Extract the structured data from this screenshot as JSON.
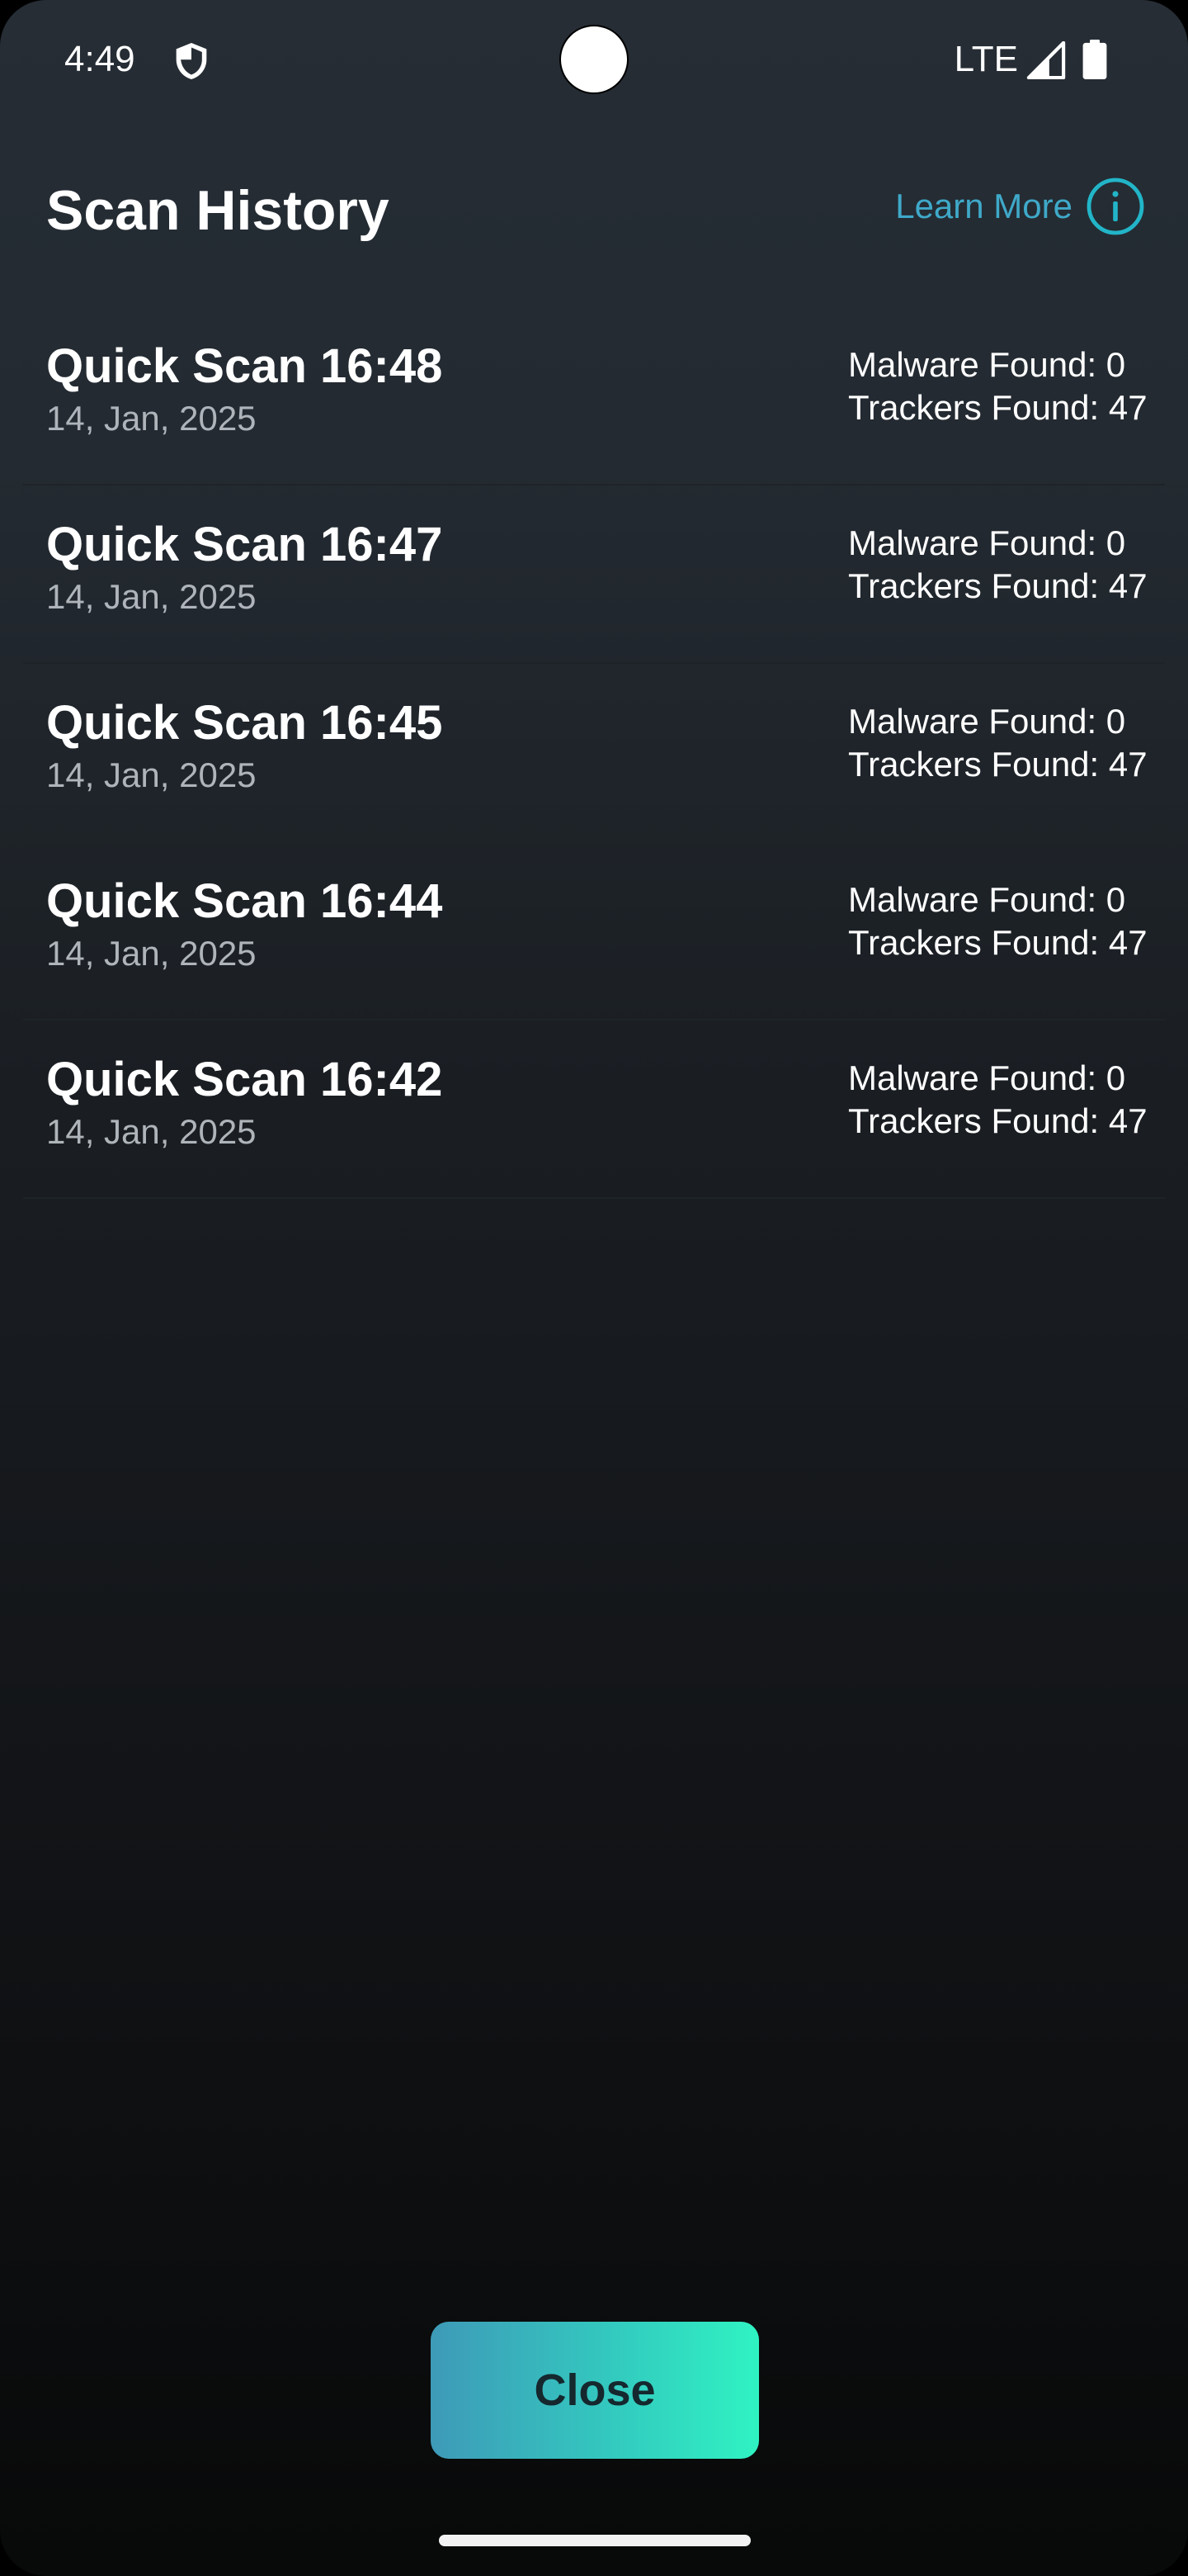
{
  "status_bar": {
    "time": "4:49",
    "network": "LTE",
    "icons": [
      "shield-icon",
      "cell-signal-icon",
      "battery-icon"
    ]
  },
  "header": {
    "title": "Scan History",
    "learn_more_label": "Learn More",
    "learn_more_icon": "info-circle-icon"
  },
  "scans": [
    {
      "title": "Quick Scan 16:48",
      "date": "14, Jan, 2025",
      "malware": "Malware Found: 0",
      "trackers": "Trackers Found: 47"
    },
    {
      "title": "Quick Scan 16:47",
      "date": "14, Jan, 2025",
      "malware": "Malware Found: 0",
      "trackers": "Trackers Found: 47"
    },
    {
      "title": "Quick Scan 16:45",
      "date": "14, Jan, 2025",
      "malware": "Malware Found: 0",
      "trackers": "Trackers Found: 47"
    },
    {
      "title": "Quick Scan 16:44",
      "date": "14, Jan, 2025",
      "malware": "Malware Found: 0",
      "trackers": "Trackers Found: 47"
    },
    {
      "title": "Quick Scan 16:42",
      "date": "14, Jan, 2025",
      "malware": "Malware Found: 0",
      "trackers": "Trackers Found: 47"
    }
  ],
  "footer": {
    "close_label": "Close"
  },
  "colors": {
    "accent": "#3fa9c9",
    "info_icon": "#22b5c8",
    "button_gradient_start": "#3e9ab8",
    "button_gradient_end": "#2ff3c2",
    "background_top": "#262d35",
    "background_bottom": "#080909"
  }
}
